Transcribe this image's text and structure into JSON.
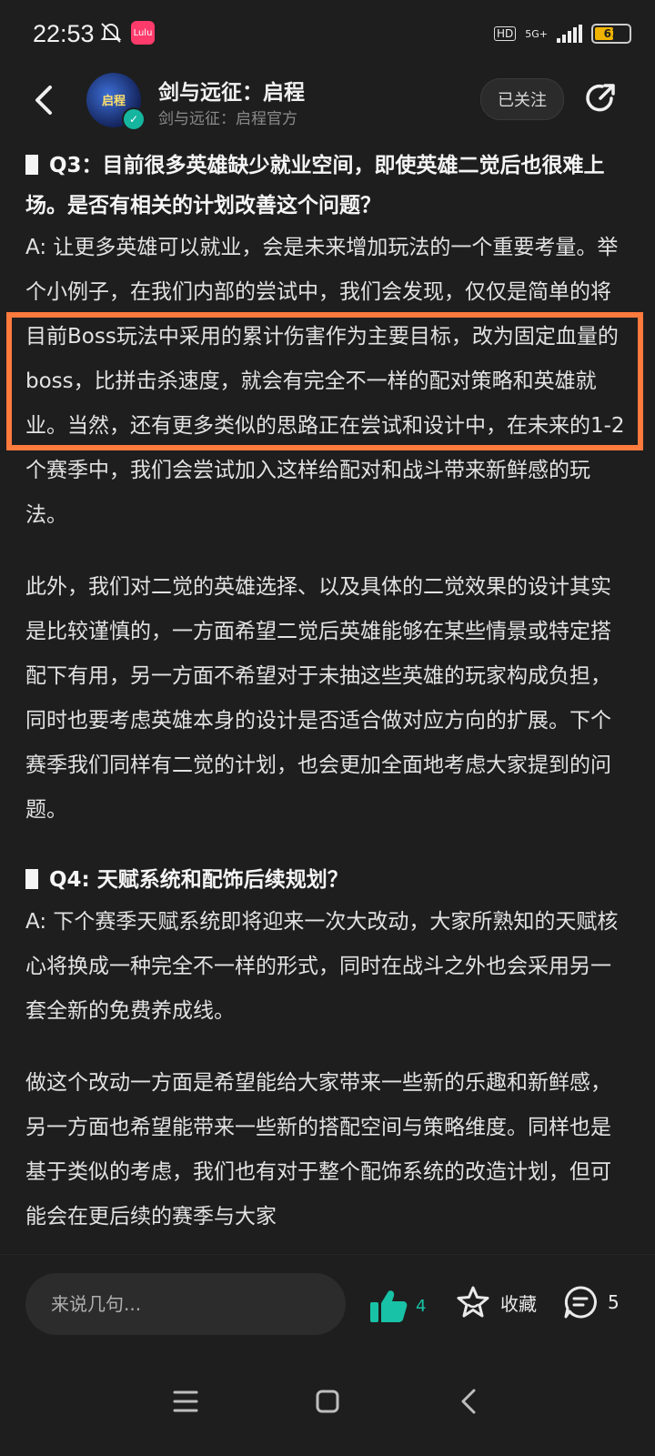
{
  "status_bar": {
    "time": "22:53",
    "app_badge": "Lulu",
    "hd": "HD",
    "network": "5G+",
    "battery_level": "61",
    "battery_fraction": 0.61
  },
  "header": {
    "title": "剑与远征：启程",
    "subtitle": "剑与远征：启程官方",
    "avatar_text": "启程",
    "follow_label": "已关注"
  },
  "article": {
    "q3_title": "Q3：目前很多英雄缺少就业空间，即使英雄二觉后也很难上场。是否有相关的计划改善这个问题？",
    "q3_answer_p1": "A: 让更多英雄可以就业，会是未来增加玩法的一个重要考量。举个小例子，在我们内部的尝试中，我们会发现，仅仅是简单的将目前Boss玩法中采用的累计伤害作为主要目标，改为固定血量的boss，比拼击杀速度，就会有完全不一样的配对策略和英雄就业。当然，还有更多类似的思路正在尝试和设计中，在未来的1-2个赛季中，我们会尝试加入这样给配对和战斗带来新鲜感的玩法。",
    "q3_answer_p2": "此外，我们对二觉的英雄选择、以及具体的二觉效果的设计其实是比较谨慎的，一方面希望二觉后英雄能够在某些情景或特定搭配下有用，另一方面不希望对于未抽这些英雄的玩家构成负担，同时也要考虑英雄本身的设计是否适合做对应方向的扩展。下个赛季我们同样有二觉的计划，也会更加全面地考虑大家提到的问题。",
    "q4_title": "Q4: 天赋系统和配饰后续规划？",
    "q4_answer_p1": "A: 下个赛季天赋系统即将迎来一次大改动，大家所熟知的天赋核心将换成一种完全不一样的形式，同时在战斗之外也会采用另一套全新的免费养成线。",
    "q4_answer_p2": "做这个改动一方面是希望能给大家带来一些新的乐趣和新鲜感，另一方面也希望能带来一些新的搭配空间与策略维度。同样也是基于类似的考虑，我们也有对于整个配饰系统的改造计划，但可能会在更后续的赛季与大家"
  },
  "bottom_bar": {
    "comment_placeholder": "来说几句...",
    "like_count": "4",
    "favorite_label": "收藏",
    "comment_count": "5"
  },
  "colors": {
    "background": "#1e1e1e",
    "accent": "#18c2a6",
    "highlight": "#ff7a3d"
  }
}
